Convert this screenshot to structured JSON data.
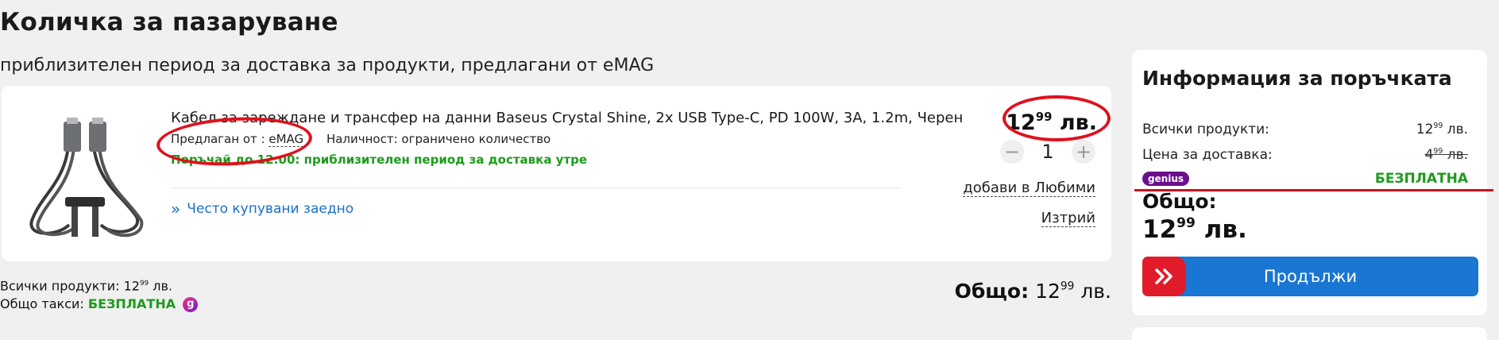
{
  "page": {
    "title": "Количка за пазаруване",
    "delivery_heading": "приблизителен период за доставка за продукти, предлагани от eMAG"
  },
  "cart_item": {
    "title": "Кабел за зареждане и трансфер на данни Baseus Crystal Shine, 2x USB Type-C, PD 100W, 3A, 1.2m, Черен",
    "seller_prefix": "Предлаган от :",
    "seller_name": "eMAG",
    "availability": "Наличност: ограничено количество",
    "order_by": "Поръчай до 12:00: приблизителен период за доставка утре",
    "bought_together": "Често купувани заедно",
    "price_whole": "12",
    "price_cents": "99",
    "price_currency": "лв.",
    "quantity": "1",
    "qty_minus": "−",
    "qty_plus": "+",
    "add_favorites": "добави в Любими",
    "delete": "Изтрий"
  },
  "cart_footer": {
    "all_products_label": "Всички продукти:",
    "all_products_whole": "12",
    "all_products_cents": "99",
    "all_products_currency": "лв.",
    "fees_label": "Общо такси:",
    "fees_value": "БЕЗПЛАТНА",
    "genius_letter": "g",
    "total_label": "Общо:",
    "total_whole": "12",
    "total_cents": "99",
    "total_currency": "лв."
  },
  "summary": {
    "title": "Информация за поръчката",
    "all_products_label": "Всички продукти:",
    "all_products_whole": "12",
    "all_products_cents": "99",
    "all_products_currency": "лв.",
    "delivery_label": "Цена за доставка:",
    "delivery_whole": "4",
    "delivery_cents": "99",
    "delivery_currency": "лв.",
    "genius_label": "genius",
    "free_label": "БЕЗПЛАТНА",
    "total_label": "Общо:",
    "total_whole": "12",
    "total_cents": "99",
    "total_currency": "лв.",
    "continue_button": "Продължи"
  },
  "colors": {
    "accent_blue": "#1976d2",
    "accent_red": "#e11b2a",
    "free_green": "#1d9b1d",
    "genius_purple": "#6b0f8e",
    "annotation_red": "#e0101c"
  },
  "icons": {
    "double_chevron": "double-chevron-right-icon",
    "continue_arrow": "double-chevron-right-icon",
    "product_image": "usb-cable-image"
  }
}
